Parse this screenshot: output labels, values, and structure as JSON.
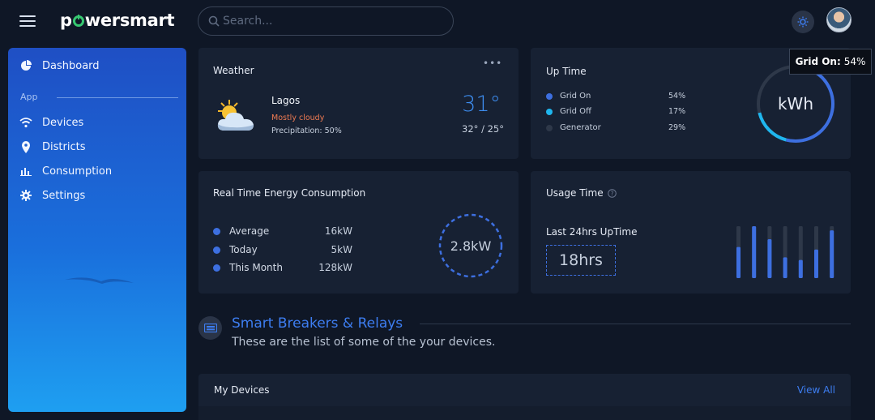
{
  "app": {
    "brand_pre": "p",
    "brand_post": "wersmart"
  },
  "search": {
    "placeholder": "Search..."
  },
  "sidebar": {
    "items": [
      {
        "label": "Dashboard",
        "icon": "pie-chart-icon"
      },
      {
        "label": "Devices",
        "icon": "wifi-icon"
      },
      {
        "label": "Districts",
        "icon": "location-pin-icon"
      },
      {
        "label": "Consumption",
        "icon": "bar-chart-icon"
      },
      {
        "label": "Settings",
        "icon": "gear-icon"
      }
    ],
    "section_label": "App"
  },
  "weather": {
    "title": "Weather",
    "city": "Lagos",
    "condition": "Mostly cloudy",
    "precipitation": "Precipitation: 50%",
    "temperature": "31°",
    "range": "32° / 25°"
  },
  "uptime": {
    "title": "Up Time",
    "center_label": "kWh",
    "legend": [
      {
        "label": "Grid On",
        "value": "54%",
        "color": "#3d6fe0"
      },
      {
        "label": "Grid Off",
        "value": "17%",
        "color": "#1fb6ee"
      },
      {
        "label": "Generator",
        "value": "29%",
        "color": "#2e3849"
      }
    ],
    "tooltip": {
      "label": "Grid On:",
      "value": "54%"
    }
  },
  "realtime": {
    "title": "Real Time Energy Consumption",
    "rows": [
      {
        "label": "Average",
        "value": "16kW"
      },
      {
        "label": "Today",
        "value": "5kW"
      },
      {
        "label": "This Month",
        "value": "128kW"
      }
    ],
    "gauge_value": "2.8kW"
  },
  "usage": {
    "title": "Usage Time",
    "subtitle": "Last 24hrs UpTime",
    "value": "18hrs",
    "bars": [
      0.6,
      1.0,
      0.75,
      0.4,
      0.35,
      0.55,
      0.92
    ]
  },
  "breakers": {
    "title": "Smart Breakers & Relays",
    "subtitle": "These are the list of some of the your devices."
  },
  "devices": {
    "title": "My Devices",
    "view_all": "View All"
  },
  "colors": {
    "accent": "#3d7df0",
    "background": "#0f1726",
    "card": "#172133"
  }
}
